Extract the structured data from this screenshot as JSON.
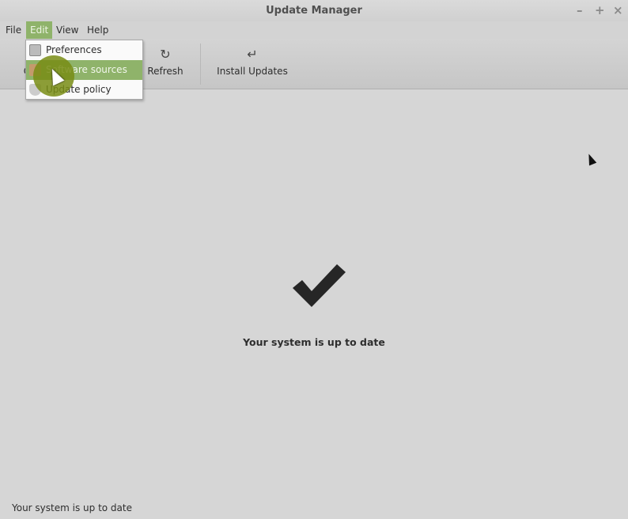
{
  "window": {
    "title": "Update Manager",
    "controls": [
      "–",
      "+",
      "×"
    ]
  },
  "menubar": {
    "items": [
      "File",
      "Edit",
      "View",
      "Help"
    ],
    "active": "Edit"
  },
  "toolbar": {
    "clear_label": "C",
    "refresh_label": "Refresh",
    "refresh_icon": "↻",
    "install_label": "Install Updates",
    "install_icon": "↵"
  },
  "edit_menu": {
    "items": [
      {
        "label": "Preferences",
        "icon": "preferences-icon"
      },
      {
        "label": "Software sources",
        "icon": "software-sources-icon",
        "highlighted": true
      },
      {
        "label": "Update policy",
        "icon": "shield-icon"
      }
    ]
  },
  "main": {
    "icon": "checkmark-icon",
    "message": "Your system is up to date"
  },
  "statusbar": {
    "text": "Your system is up to date"
  },
  "colors": {
    "accent": "#8fb36a",
    "background": "#d6d6d6"
  }
}
